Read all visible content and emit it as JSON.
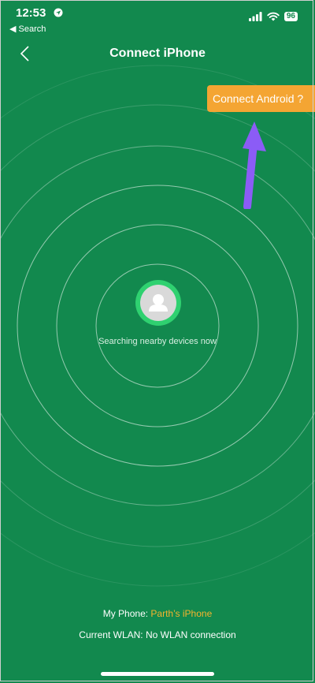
{
  "status": {
    "time": "12:53",
    "back_app": "◀ Search",
    "battery": "96"
  },
  "nav": {
    "title": "Connect iPhone"
  },
  "connect_android": {
    "label": "Connect Android ?"
  },
  "search": {
    "status_text": "Searching nearby devices now"
  },
  "footer": {
    "my_phone_label": "My Phone: ",
    "my_phone_name": "Parth’s iPhone",
    "wlan_label": "Current WLAN: ",
    "wlan_value": "No WLAN connection"
  },
  "icons": [
    "location-icon",
    "signal-icon",
    "wifi-icon",
    "battery-icon",
    "back-chevron-icon",
    "avatar-icon",
    "arrow-icon"
  ],
  "colors": {
    "background": "#12894e",
    "accent": "#f4a533",
    "phone_name": "#f4b42e",
    "avatar_ring": "#2fd170",
    "annotation_arrow": "#8b5cf6"
  }
}
